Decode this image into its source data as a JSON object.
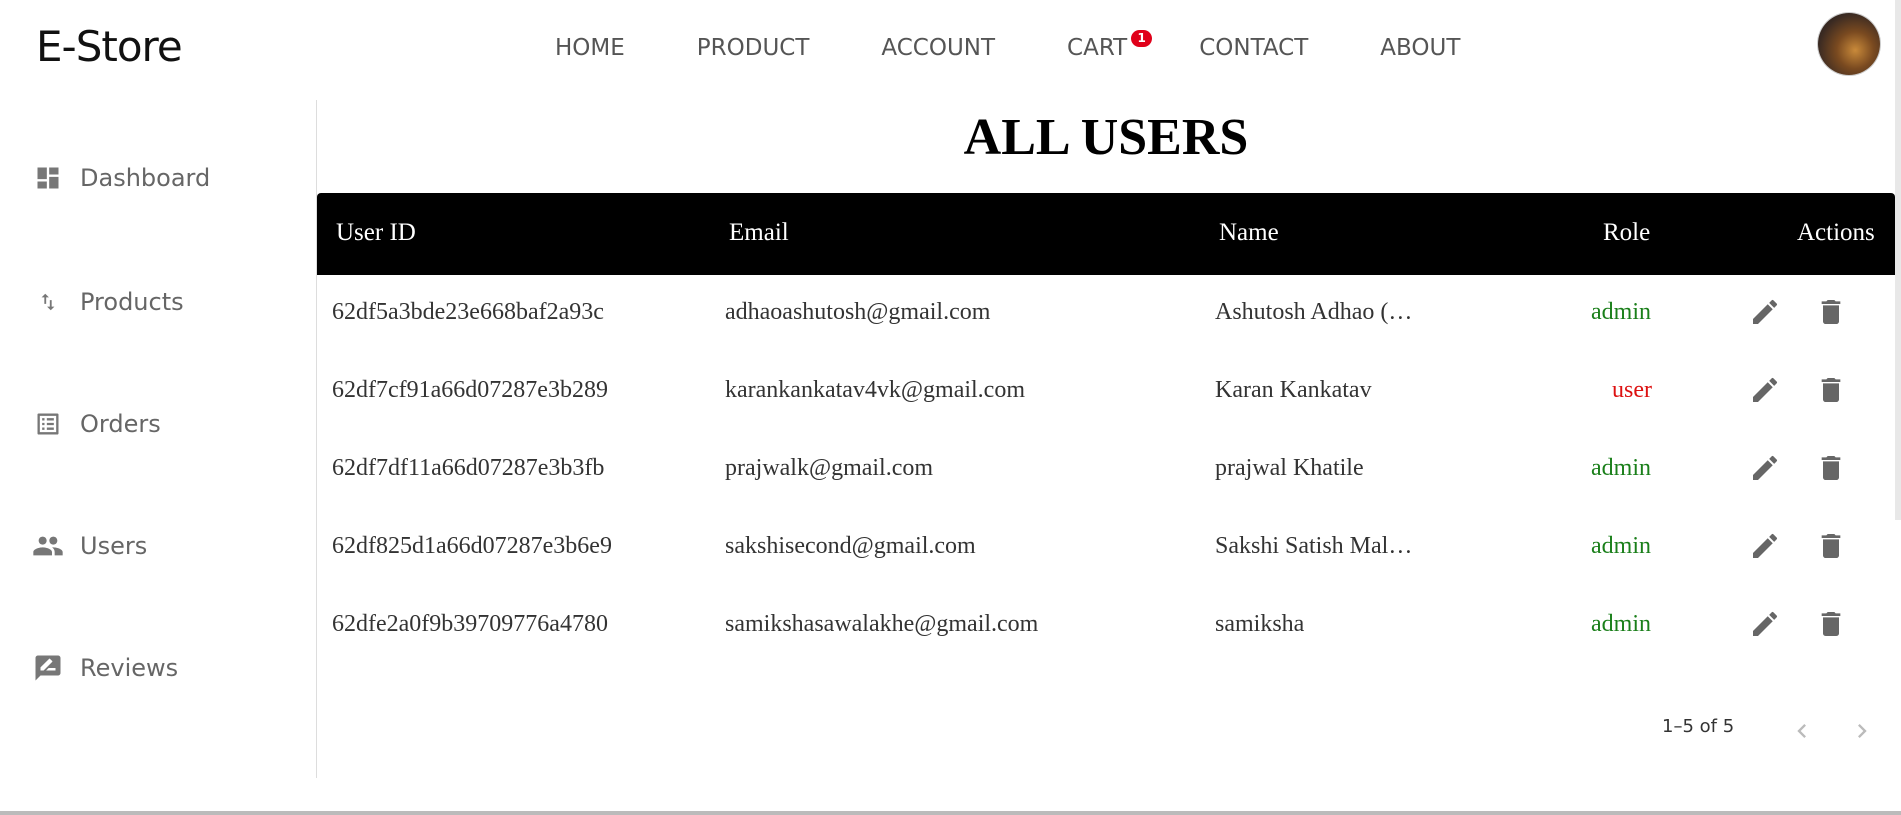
{
  "header": {
    "logo": "E-Store",
    "nav": [
      {
        "label": "HOME"
      },
      {
        "label": "PRODUCT"
      },
      {
        "label": "ACCOUNT"
      },
      {
        "label": "CART",
        "badge": "1"
      },
      {
        "label": "CONTACT"
      },
      {
        "label": "ABOUT"
      }
    ]
  },
  "sidebar": {
    "items": [
      {
        "label": "Dashboard",
        "icon": "dashboard-icon"
      },
      {
        "label": "Products",
        "icon": "import-export-icon"
      },
      {
        "label": "Orders",
        "icon": "list-alt-icon"
      },
      {
        "label": "Users",
        "icon": "people-icon"
      },
      {
        "label": "Reviews",
        "icon": "rate-review-icon"
      }
    ]
  },
  "main": {
    "title": "ALL USERS",
    "columns": [
      "User ID",
      "Email",
      "Name",
      "Role",
      "Actions"
    ],
    "rows": [
      {
        "id": "62df5a3bde23e668baf2a93c",
        "email": "adhaoashutosh@gmail.com",
        "name": "Ashutosh Adhao (…",
        "role": "admin"
      },
      {
        "id": "62df7cf91a66d07287e3b289",
        "email": "karankankatav4vk@gmail.com",
        "name": "Karan Kankatav",
        "role": "user"
      },
      {
        "id": "62df7df11a66d07287e3b3fb",
        "email": "prajwalk@gmail.com",
        "name": "prajwal Khatile",
        "role": "admin"
      },
      {
        "id": "62df825d1a66d07287e3b6e9",
        "email": "sakshisecond@gmail.com",
        "name": "Sakshi Satish Mal…",
        "role": "admin"
      },
      {
        "id": "62dfe2a0f9b39709776a4780",
        "email": "samikshasawalakhe@gmail.com",
        "name": "samiksha",
        "role": "admin"
      }
    ],
    "pagination": {
      "text": "1–5 of 5"
    }
  },
  "colors": {
    "admin": "#1a7f1a",
    "user": "#dd1111",
    "header_bg": "#000000",
    "badge": "#e0001a"
  }
}
